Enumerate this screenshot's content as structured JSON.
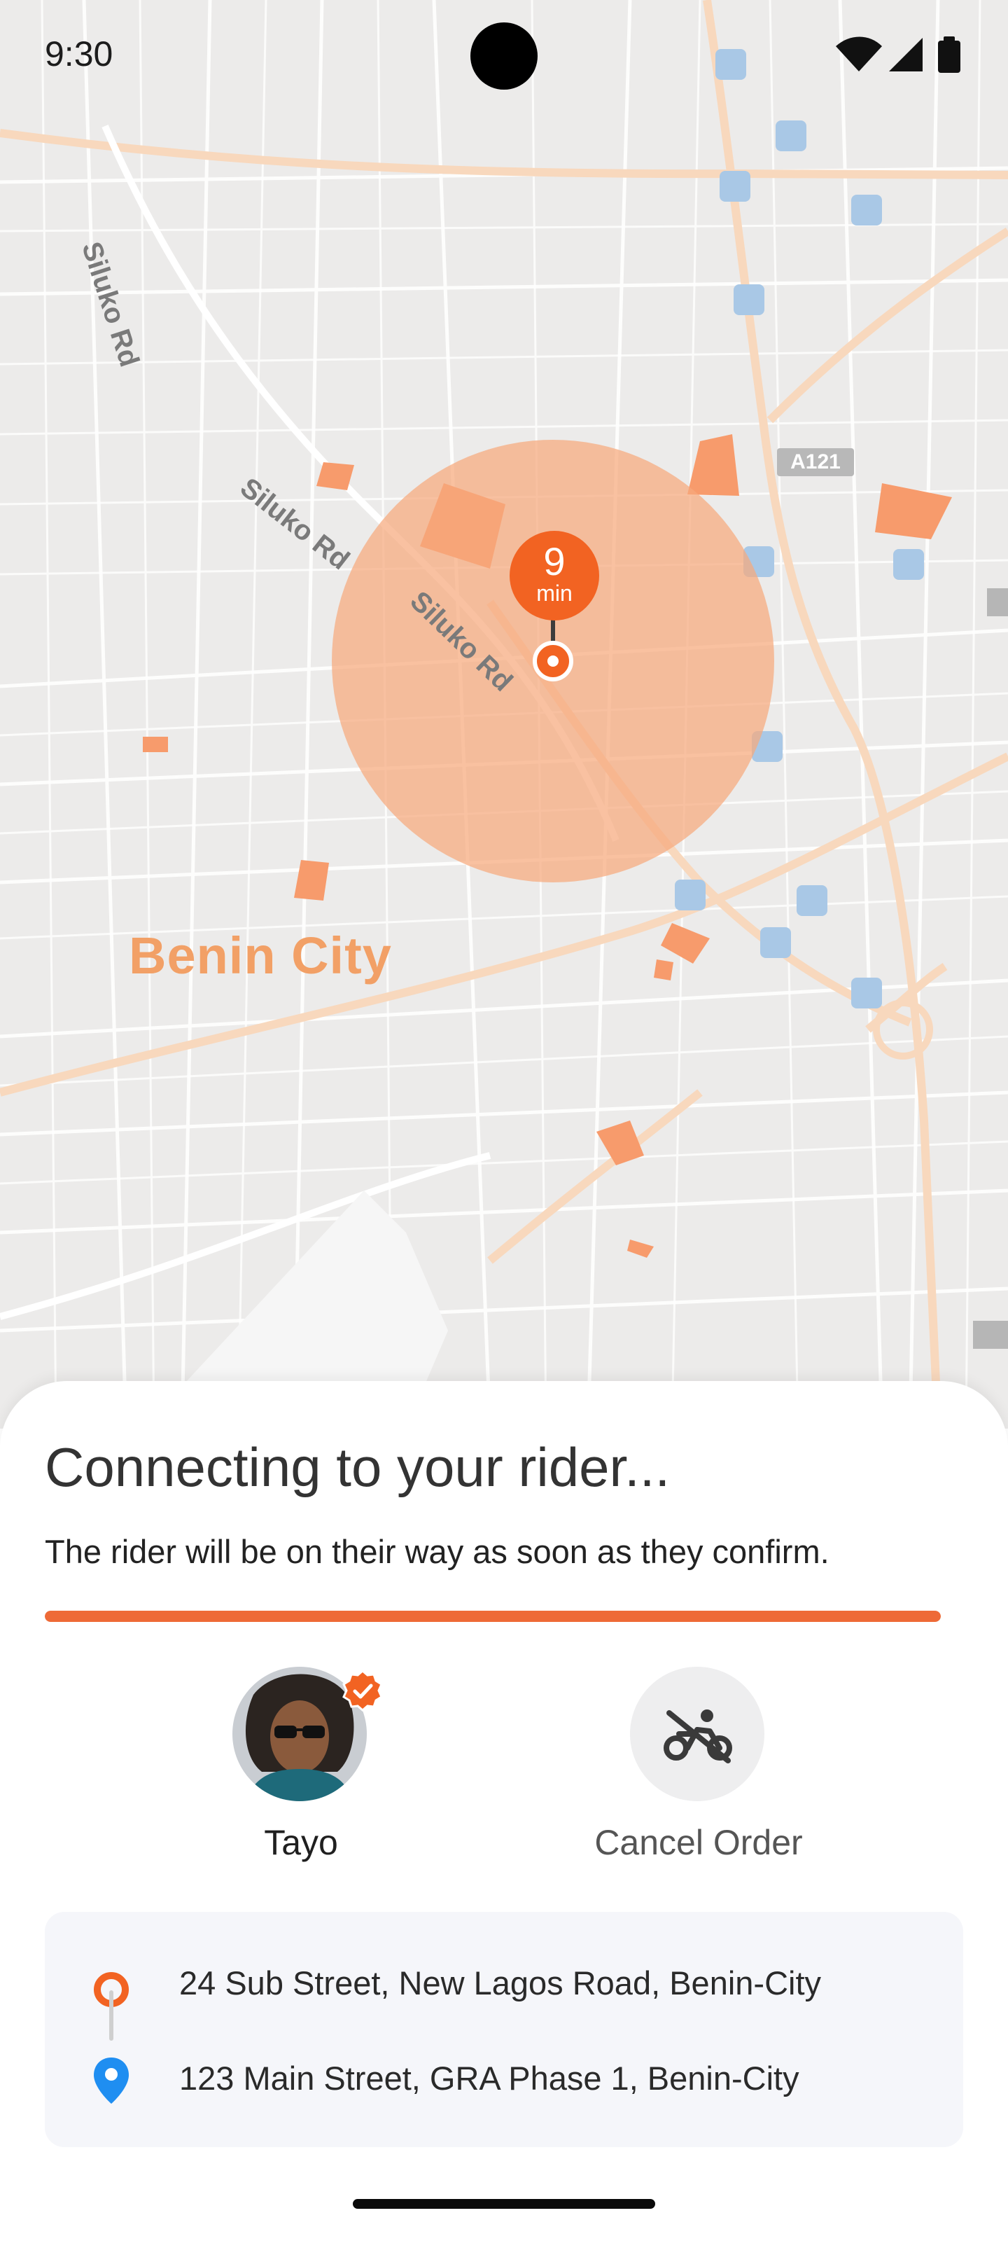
{
  "status_bar": {
    "time": "9:30",
    "icons": [
      "wifi-icon",
      "signal-icon",
      "battery-icon"
    ]
  },
  "map": {
    "city_label": "Benin City",
    "road_labels": [
      "Siluko Rd",
      "Siluko Rd",
      "Siluko Rd"
    ],
    "route_shield": "A121",
    "eta": {
      "value": "9",
      "unit": "min"
    },
    "accent_color": "#f26322"
  },
  "sheet": {
    "title": "Connecting to your rider...",
    "subtitle": "The rider will be on their way as soon as they confirm.",
    "progress_percent": 100,
    "progress_color": "#ee6a37",
    "rider": {
      "name": "Tayo",
      "verified": true
    },
    "cancel": {
      "label": "Cancel Order",
      "icon": "cancel-ride-icon"
    },
    "route": {
      "pickup": "24 Sub Street, New Lagos Road, Benin-City",
      "dropoff": "123 Main Street, GRA Phase 1, Benin-City"
    }
  }
}
